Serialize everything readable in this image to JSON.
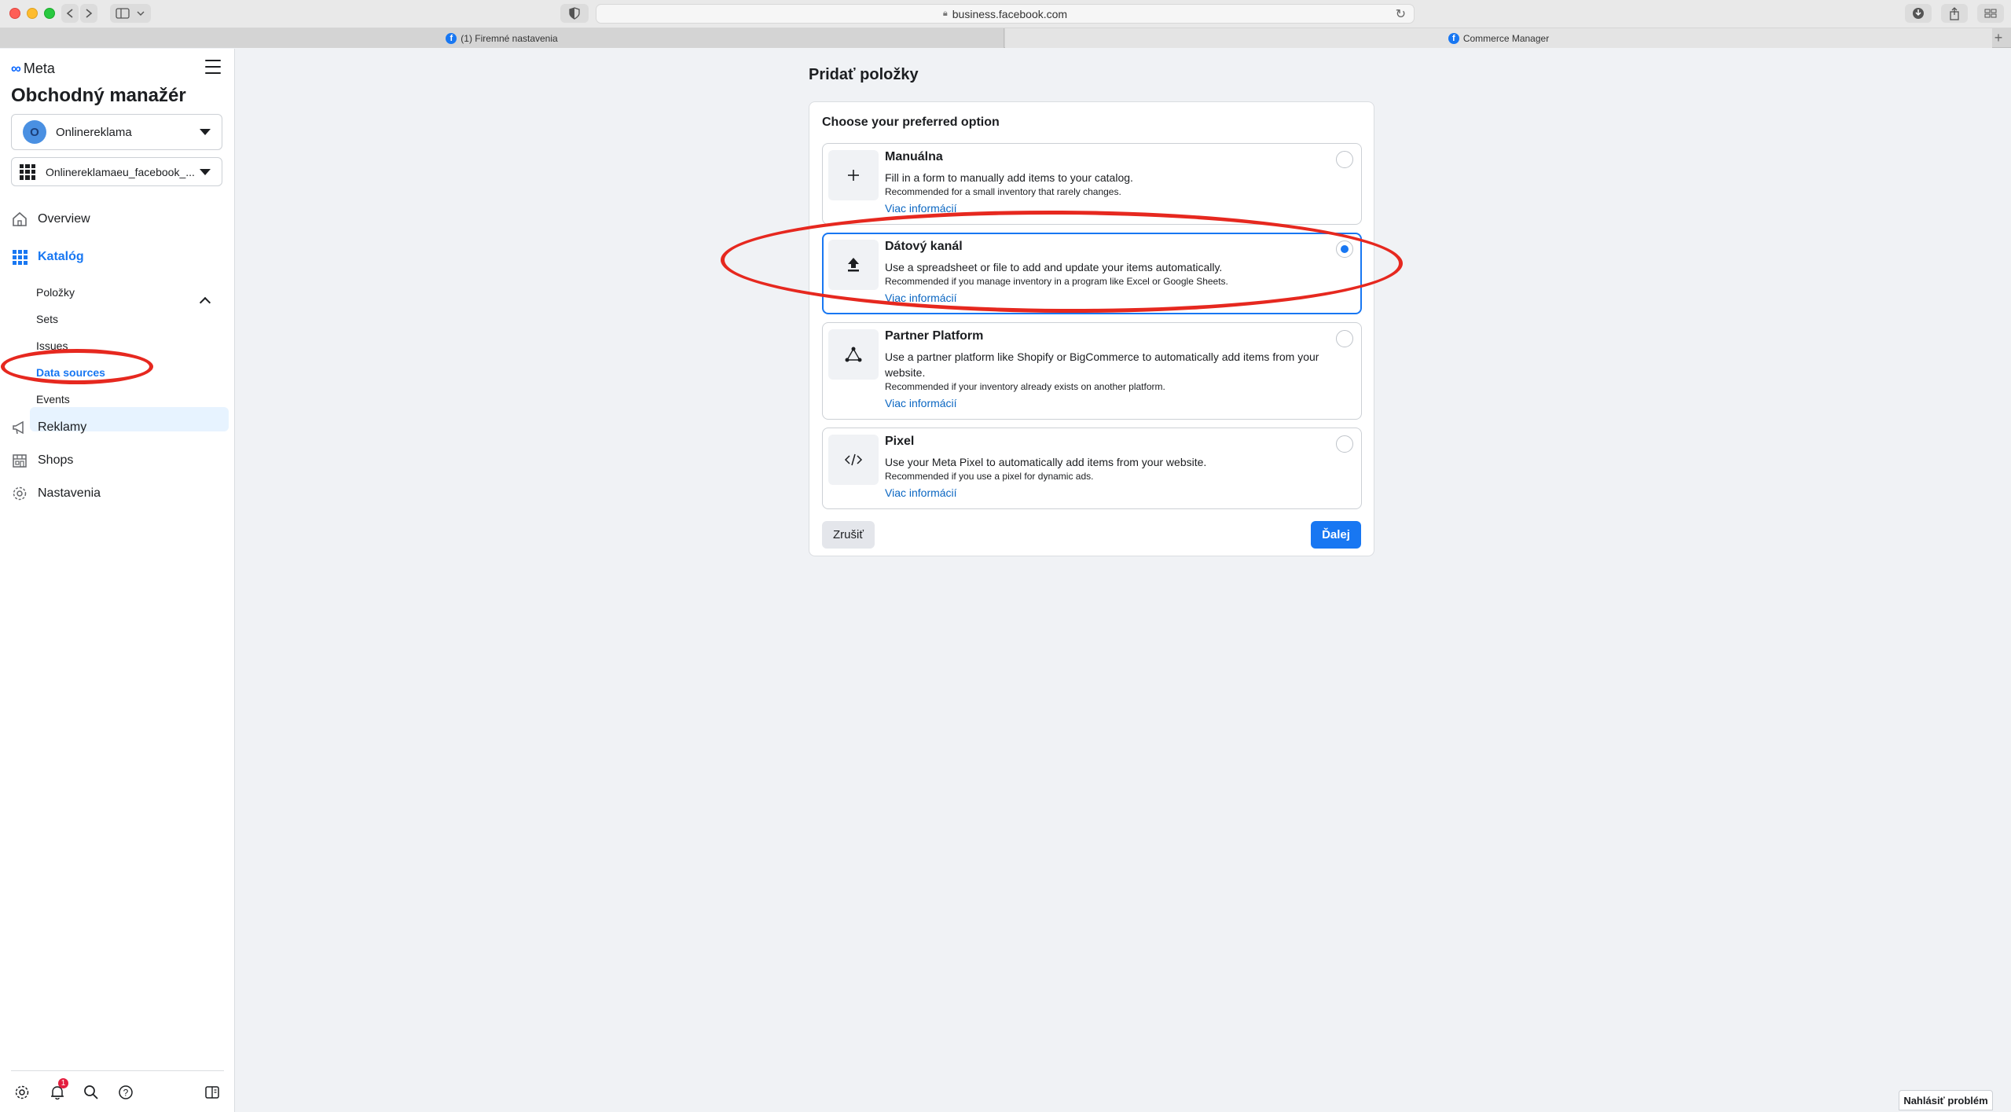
{
  "browser": {
    "url": "business.facebook.com",
    "tabs": [
      {
        "label": "(1) Firemné nastavenia"
      },
      {
        "label": "Commerce Manager"
      }
    ]
  },
  "sidebar": {
    "brand": "Meta",
    "app_title": "Obchodný manažér",
    "account": {
      "initial": "O",
      "name": "Onlinereklama"
    },
    "catalog_name": "Onlinereklamaeu_facebook_...",
    "nav": {
      "overview": "Overview",
      "katalog": "Katalóg",
      "reklamy": "Reklamy",
      "shops": "Shops",
      "nastavenia": "Nastavenia"
    },
    "katalog_sub": {
      "polozky": "Položky",
      "sets": "Sets",
      "issues": "Issues",
      "data_sources": "Data sources",
      "events": "Events"
    },
    "notification_count": "1"
  },
  "main": {
    "page_title": "Pridať položky",
    "card_heading": "Choose your preferred option",
    "options": [
      {
        "title": "Manuálna",
        "description": "Fill in a form to manually add items to your catalog.",
        "recommendation": "Recommended for a small inventory that rarely changes.",
        "link": "Viac informácií",
        "icon": "plus-icon"
      },
      {
        "title": "Dátový kanál",
        "description": "Use a spreadsheet or file to add and update your items automatically.",
        "recommendation": "Recommended if you manage inventory in a program like Excel or Google Sheets.",
        "link": "Viac informácií",
        "icon": "upload-icon"
      },
      {
        "title": "Partner Platform",
        "description": "Use a partner platform like Shopify or BigCommerce to automatically add items from your website.",
        "recommendation": "Recommended if your inventory already exists on another platform.",
        "link": "Viac informácií",
        "icon": "partner-icon"
      },
      {
        "title": "Pixel",
        "description": "Use your Meta Pixel to automatically add items from your website.",
        "recommendation": "Recommended if you use a pixel for dynamic ads.",
        "link": "Viac informácií",
        "icon": "code-icon"
      }
    ],
    "selected_option": "Dátový kanál",
    "cancel_label": "Zrušiť",
    "next_label": "Ďalej"
  },
  "report_problem": "Nahlásiť problém",
  "colors": {
    "accent": "#1877f2",
    "annotation": "#e6281f"
  }
}
